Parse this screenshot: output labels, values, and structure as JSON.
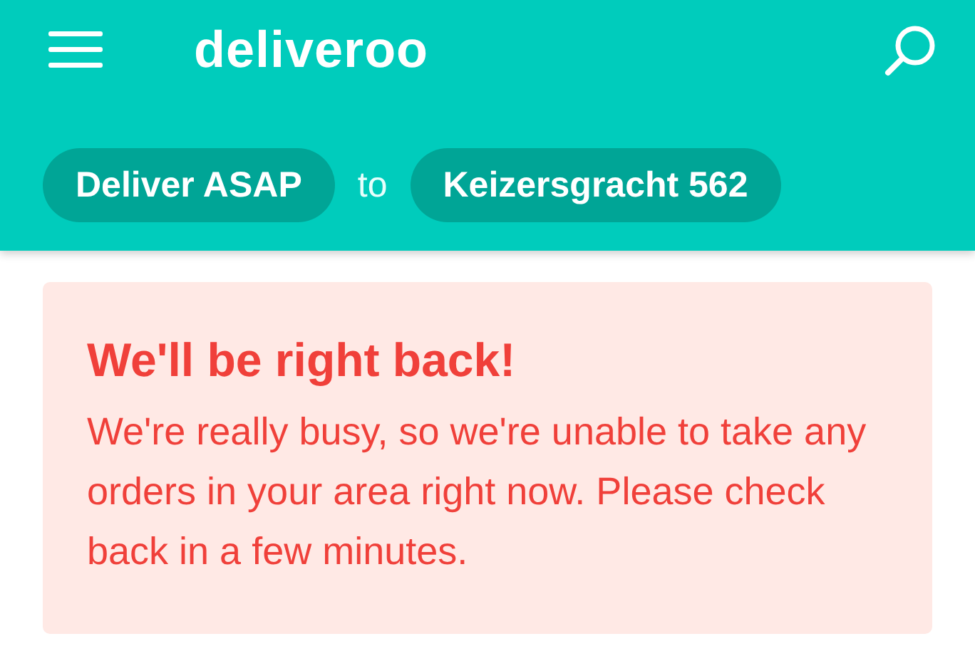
{
  "header": {
    "logo": "deliveroo",
    "delivery_time": "Deliver ASAP",
    "connector": "to",
    "address": "Keizersgracht 562"
  },
  "notice": {
    "title": "We'll be right back!",
    "message": "We're really busy, so we're unable to take any orders in your area right now. Please check back in a few minutes."
  }
}
